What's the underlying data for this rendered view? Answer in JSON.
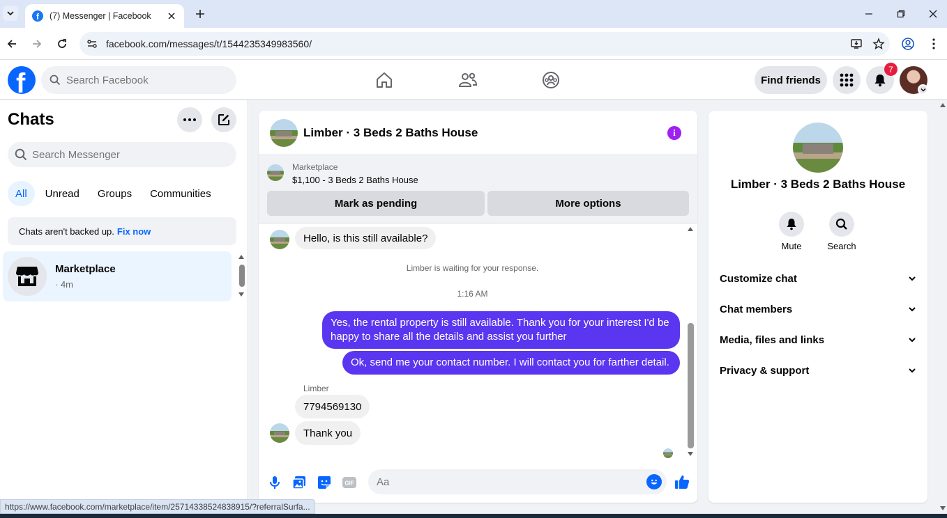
{
  "browser": {
    "tab_title": "(7) Messenger | Facebook",
    "url": "facebook.com/messages/t/1544235349983560/",
    "status_url": "https://www.facebook.com/marketplace/item/25714338524838915/?referralSurfa..."
  },
  "header": {
    "search_placeholder": "Search Facebook",
    "find_friends_label": "Find friends",
    "notification_count": "7"
  },
  "sidebar": {
    "title": "Chats",
    "search_placeholder": "Search Messenger",
    "filters": [
      "All",
      "Unread",
      "Groups",
      "Communities"
    ],
    "backup_text": "Chats aren't backed up.",
    "backup_link": "Fix now",
    "chats": [
      {
        "name": "Marketplace",
        "time": "· 4m"
      }
    ]
  },
  "conversation": {
    "title": "Limber · 3 Beds 2 Baths House",
    "marketplace_label": "Marketplace",
    "listing": "$1,100 - 3 Beds 2 Baths House",
    "mark_pending_label": "Mark as pending",
    "more_options_label": "More options",
    "messages": [
      {
        "from": "them",
        "text": "Hello, is this still available?"
      },
      {
        "from": "system",
        "text": "Limber is waiting for your response."
      },
      {
        "from": "time",
        "text": "1:16 AM"
      },
      {
        "from": "me",
        "text": "Yes, the rental property is still available. Thank you for your interest I'd be happy to share all the details and assist you further"
      },
      {
        "from": "me",
        "text": "Ok, send me your contact number. I will contact you for farther detail."
      },
      {
        "from": "sender",
        "text": "Limber"
      },
      {
        "from": "them",
        "text": "7794569130"
      },
      {
        "from": "them",
        "text": "Thank you"
      }
    ],
    "composer_placeholder": "Aa"
  },
  "details": {
    "name": "Limber · 3 Beds 2 Baths House",
    "actions": [
      "Mute",
      "Search"
    ],
    "sections": [
      "Customize chat",
      "Chat members",
      "Media, files and links",
      "Privacy & support"
    ]
  },
  "colors": {
    "brand": "#0866ff",
    "outgoing_bubble": "#5b36f0",
    "info_icon": "#a020f0",
    "badge": "#e41e3f"
  }
}
